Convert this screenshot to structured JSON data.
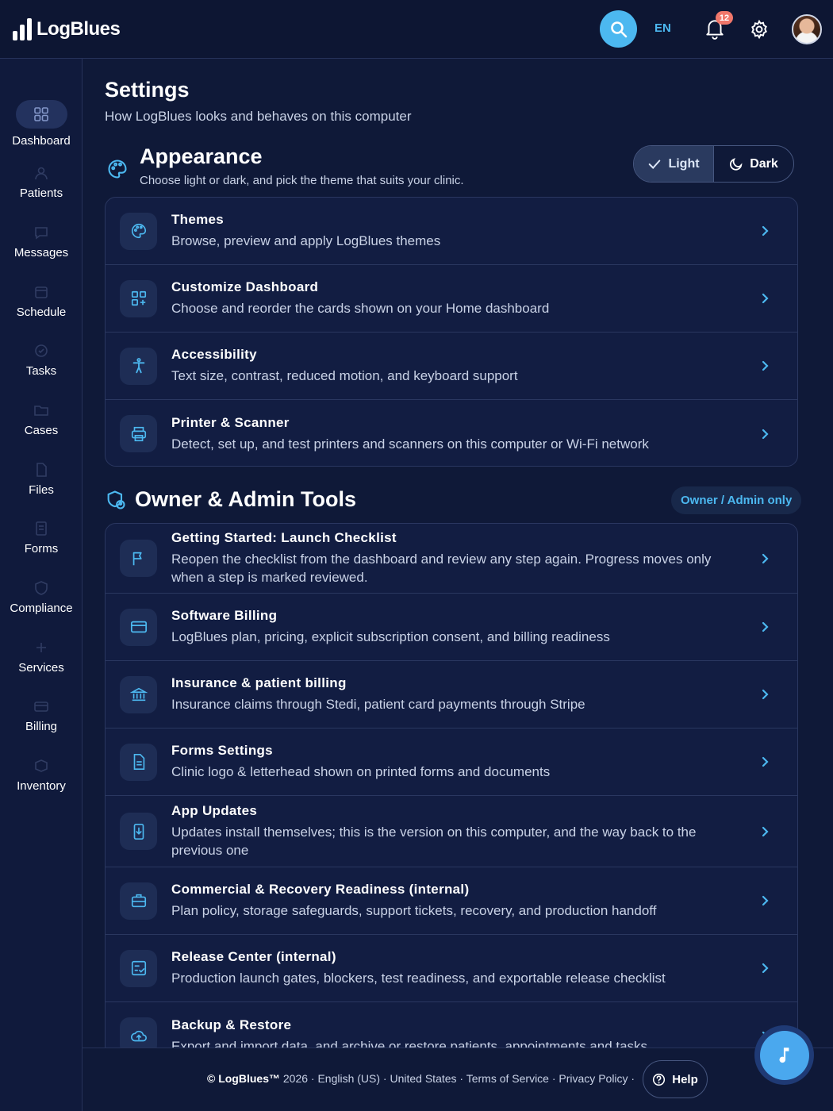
{
  "brand": {
    "name": "LogBlues"
  },
  "topbar": {
    "language": "EN",
    "notification_count": "12"
  },
  "sidebar": {
    "items": [
      {
        "label": "Dashboard",
        "icon": "grid-icon",
        "active": true
      },
      {
        "label": "Patients",
        "icon": "patients-icon"
      },
      {
        "label": "Messages",
        "icon": "message-icon"
      },
      {
        "label": "Schedule",
        "icon": "calendar-icon"
      },
      {
        "label": "Tasks",
        "icon": "task-icon"
      },
      {
        "label": "Cases",
        "icon": "folder-icon"
      },
      {
        "label": "Files",
        "icon": "file-icon"
      },
      {
        "label": "Forms",
        "icon": "form-icon"
      },
      {
        "label": "Compliance",
        "icon": "shield-icon"
      },
      {
        "label": "Services",
        "icon": "services-icon"
      },
      {
        "label": "Billing",
        "icon": "billing-icon"
      },
      {
        "label": "Inventory",
        "icon": "box-icon"
      }
    ]
  },
  "page": {
    "title": "Settings",
    "subtitle": "How LogBlues looks and behaves on this computer"
  },
  "appearance": {
    "title": "Appearance",
    "subtitle": "Choose light or dark, and pick the theme that suits your clinic.",
    "toggle_light": "Light",
    "toggle_dark": "Dark",
    "items": [
      {
        "title": "Themes",
        "desc": "Browse, preview and apply LogBlues themes",
        "icon": "palette-icon"
      },
      {
        "title": "Customize Dashboard",
        "desc": "Choose and reorder the cards shown on your Home dashboard",
        "icon": "dashboard-add-icon"
      },
      {
        "title": "Accessibility",
        "desc": "Text size, contrast, reduced motion, and keyboard support",
        "icon": "accessibility-icon"
      },
      {
        "title": "Printer & Scanner",
        "desc": "Detect, set up, and test printers and scanners on this computer or Wi-Fi network",
        "icon": "printer-icon"
      }
    ]
  },
  "admin": {
    "title": "Owner & Admin Tools",
    "badge": "Owner / Admin only",
    "items": [
      {
        "title": "Getting Started: Launch Checklist",
        "desc": "Reopen the checklist from the dashboard and review any step again. Progress moves only when a step is marked reviewed.",
        "icon": "flag-icon"
      },
      {
        "title": "Software Billing",
        "desc": "LogBlues plan, pricing, explicit subscription consent, and billing readiness",
        "icon": "credit-card-icon"
      },
      {
        "title": "Insurance & patient billing",
        "desc": "Insurance claims through Stedi, patient card payments through Stripe",
        "icon": "bank-icon"
      },
      {
        "title": "Forms Settings",
        "desc": "Clinic logo & letterhead shown on printed forms and documents",
        "icon": "document-icon"
      },
      {
        "title": "App Updates",
        "desc": "Updates install themselves; this is the version on this computer, and the way back to the previous one",
        "icon": "download-icon"
      },
      {
        "title": "Commercial & Recovery Readiness (internal)",
        "desc": "Plan policy, storage safeguards, support tickets, recovery, and production handoff",
        "icon": "briefcase-icon"
      },
      {
        "title": "Release Center (internal)",
        "desc": "Production launch gates, blockers, test readiness, and exportable release checklist",
        "icon": "checklist-icon"
      },
      {
        "title": "Backup & Restore",
        "desc": "Export and import data, and archive or restore patients, appointments and tasks",
        "icon": "cloud-upload-icon"
      }
    ]
  },
  "footer": {
    "brand": "© LogBlues™",
    "text": " 2026 · English (US) · United States · Terms of Service · Privacy Policy ·",
    "help": "Help"
  },
  "colors": {
    "accent": "#4cb8f0",
    "background": "#0f1938",
    "badge": "#f0776b"
  }
}
